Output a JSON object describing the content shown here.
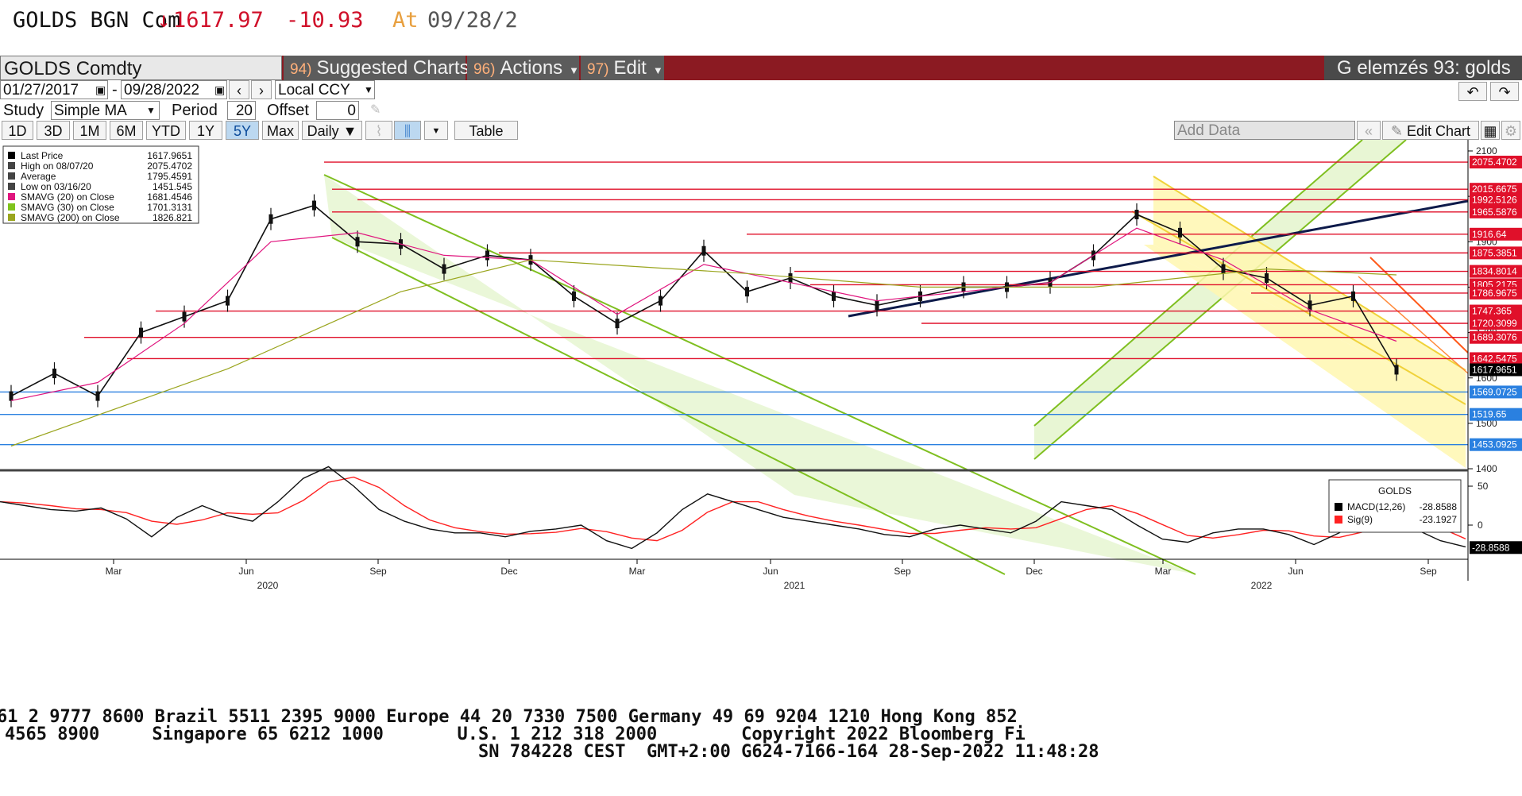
{
  "quote": {
    "ticker": "GOLDS BGN Com",
    "arrow": "↓",
    "price": "1617.97",
    "change": "-10.93",
    "at_label": "At",
    "time": "09/28/2"
  },
  "titlebar": {
    "security": "GOLDS Comdty",
    "suggested_num": "94)",
    "suggested_label": "Suggested Charts",
    "actions_num": "96)",
    "actions_label": "Actions",
    "edit_num": "97)",
    "edit_label": "Edit",
    "right_title": "G elemzés 93: golds"
  },
  "controls": {
    "start_date": "01/27/2017",
    "end_date": "09/28/2022",
    "dash": "-",
    "currency": "Local CCY",
    "study_label": "Study",
    "study_value": "Simple MA",
    "period_label": "Period",
    "period_value": "20",
    "offset_label": "Offset",
    "offset_value": "0",
    "ranges": [
      "1D",
      "3D",
      "1M",
      "6M",
      "YTD",
      "1Y",
      "5Y",
      "Max"
    ],
    "active_range": "5Y",
    "frequency": "Daily ▼",
    "table_label": "Table",
    "add_data_placeholder": "Add Data",
    "edit_chart_label": "Edit Chart"
  },
  "legend": {
    "rows": [
      {
        "label": "Last Price",
        "value": "1617.9651",
        "color": "#000000"
      },
      {
        "label": "High on 08/07/20",
        "value": "2075.4702",
        "color": "#444444"
      },
      {
        "label": "Average",
        "value": "1795.4591",
        "color": "#444444"
      },
      {
        "label": "Low on 03/16/20",
        "value": "1451.545",
        "color": "#444444"
      },
      {
        "label": "SMAVG (20)  on Close",
        "value": "1681.4546",
        "color": "#e0157e"
      },
      {
        "label": "SMAVG (30)  on Close",
        "value": "1701.3131",
        "color": "#7fc31c"
      },
      {
        "label": "SMAVG (200)  on Close",
        "value": "1826.821",
        "color": "#9aa51e"
      }
    ]
  },
  "macd_legend": {
    "title": "GOLDS",
    "rows": [
      {
        "label": "MACD(12,26)",
        "value": "-28.8588",
        "color": "#000000"
      },
      {
        "label": "Sig(9)",
        "value": "-23.1927",
        "color": "#ff2222"
      }
    ]
  },
  "price_labels": [
    {
      "value": "2075.4702",
      "y": 2075.47
    },
    {
      "value": "2015.6675",
      "y": 2015.67
    },
    {
      "value": "1992.5126",
      "y": 1992.51
    },
    {
      "value": "1965.5876",
      "y": 1965.59
    },
    {
      "value": "1916.64",
      "y": 1916.64
    },
    {
      "value": "1875.3851",
      "y": 1875.39
    },
    {
      "value": "1834.8014",
      "y": 1834.8
    },
    {
      "value": "1805.2175",
      "y": 1805.22
    },
    {
      "value": "1786.9675",
      "y": 1786.97
    },
    {
      "value": "1747.365",
      "y": 1747.37
    },
    {
      "value": "1720.3099",
      "y": 1720.31
    },
    {
      "value": "1689.3076",
      "y": 1689.31
    },
    {
      "value": "1642.5475",
      "y": 1642.55
    },
    {
      "value": "1617.9651",
      "y": 1617.97,
      "current": true
    }
  ],
  "blue_labels": [
    {
      "value": "1569.0725",
      "y": 1569.07
    },
    {
      "value": "1519.65",
      "y": 1519.65
    },
    {
      "value": "1453.0925",
      "y": 1453.09
    }
  ],
  "y_ticks": [
    "2100",
    "2000",
    "1900",
    "1800",
    "1700",
    "1600",
    "1500",
    "1400"
  ],
  "macd_ticks": [
    "50",
    "0"
  ],
  "macd_current": "-28.8588",
  "x_ticks": [
    "Mar",
    "Jun",
    "Sep",
    "Dec",
    "Mar",
    "Jun",
    "Sep",
    "Dec",
    "Mar",
    "Jun",
    "Sep"
  ],
  "x_years": [
    "2020",
    "2021",
    "2022"
  ],
  "ticker_lines": [
    "61 2 9777 8600 Brazil 5511 2395 9000 Europe 44 20 7330 7500 Germany 49 69 9204 1210 Hong Kong 852",
    "4565 8900     Singapore 65 6212 1000       U.S. 1 212 318 2000        Copyright 2022 Bloomberg Fi",
    "                                             SN 784228 CEST  GMT+2:00 G624-7166-164 28-Sep-2022 11:48:28"
  ],
  "chart_data": {
    "type": "line",
    "title": "",
    "xlabel": "",
    "ylabel": "",
    "ylim": [
      1360,
      2120
    ],
    "x_range": [
      "2019-12",
      "2022-09"
    ],
    "series": [
      {
        "name": "Last Price",
        "x": [
          "2020-01",
          "2020-02",
          "2020-03",
          "2020-04",
          "2020-05",
          "2020-06",
          "2020-07",
          "2020-08",
          "2020-09",
          "2020-10",
          "2020-11",
          "2020-12",
          "2021-01",
          "2021-02",
          "2021-03",
          "2021-04",
          "2021-05",
          "2021-06",
          "2021-07",
          "2021-08",
          "2021-09",
          "2021-10",
          "2021-11",
          "2021-12",
          "2022-01",
          "2022-02",
          "2022-03",
          "2022-04",
          "2022-05",
          "2022-06",
          "2022-07",
          "2022-08",
          "2022-09"
        ],
        "values": [
          1560,
          1610,
          1560,
          1700,
          1735,
          1770,
          1950,
          1980,
          1900,
          1895,
          1840,
          1870,
          1860,
          1780,
          1720,
          1770,
          1880,
          1790,
          1820,
          1780,
          1760,
          1780,
          1800,
          1800,
          1810,
          1870,
          1960,
          1920,
          1840,
          1820,
          1760,
          1780,
          1618
        ]
      },
      {
        "name": "SMAVG (20)  on Close",
        "x": [
          "2020-01",
          "2020-03",
          "2020-05",
          "2020-07",
          "2020-09",
          "2020-11",
          "2021-01",
          "2021-03",
          "2021-05",
          "2021-07",
          "2021-09",
          "2021-11",
          "2022-01",
          "2022-03",
          "2022-05",
          "2022-07",
          "2022-09"
        ],
        "values": [
          1550,
          1590,
          1720,
          1900,
          1920,
          1870,
          1860,
          1740,
          1850,
          1810,
          1770,
          1790,
          1810,
          1930,
          1860,
          1750,
          1681
        ]
      },
      {
        "name": "SMAVG (200)  on Close",
        "x": [
          "2020-01",
          "2020-06",
          "2020-10",
          "2021-01",
          "2021-06",
          "2021-10",
          "2022-02",
          "2022-06",
          "2022-09"
        ],
        "values": [
          1450,
          1620,
          1790,
          1860,
          1830,
          1800,
          1800,
          1840,
          1827
        ]
      }
    ]
  }
}
